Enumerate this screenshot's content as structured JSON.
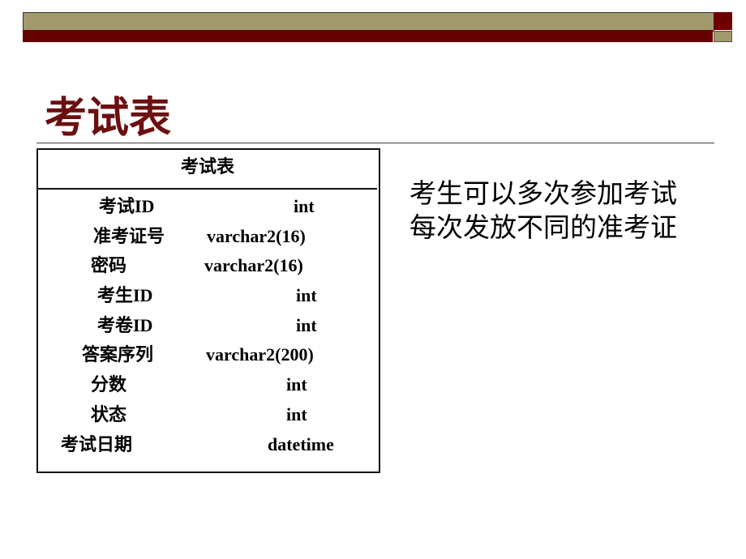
{
  "slide": {
    "title": "考试表",
    "table": {
      "header": "考试表",
      "rows": [
        {
          "field": "考试ID",
          "type": "int"
        },
        {
          "field": "准考证号",
          "type": "varchar2(16)"
        },
        {
          "field": "密码",
          "type": "varchar2(16)"
        },
        {
          "field": "考生ID",
          "type": "int"
        },
        {
          "field": "考卷ID",
          "type": "int"
        },
        {
          "field": "答案序列",
          "type": "varchar2(200)"
        },
        {
          "field": "分数",
          "type": "int"
        },
        {
          "field": "状态",
          "type": "int"
        },
        {
          "field": "考试日期",
          "type": "datetime"
        }
      ]
    },
    "notes": [
      "考生可以多次参加考试",
      "每次发放不同的准考证"
    ],
    "colors": {
      "title": "#6b0f10",
      "band_olive": "#a09a6c",
      "band_maroon": "#640000"
    }
  }
}
